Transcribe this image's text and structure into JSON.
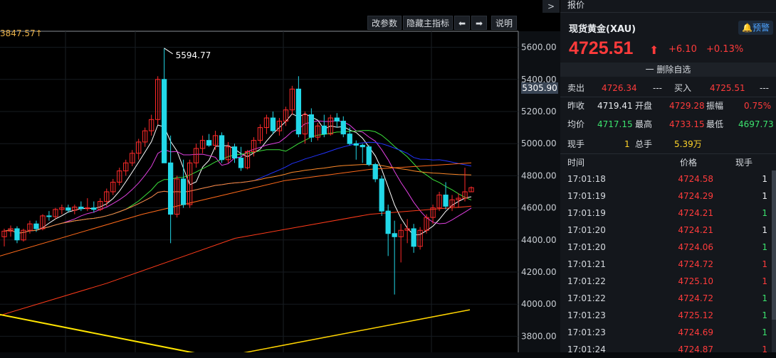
{
  "toolbar": {
    "modify_params": "改参数",
    "hide_indicator": "隐藏主指标",
    "left_arrow": "⬅",
    "right_arrow": "➡",
    "explain": "说明",
    "scroll_arrow": ">"
  },
  "chart_label": "3847.57↑",
  "current_price_tag": "5305.90",
  "chart_data": {
    "type": "candlestick",
    "y_axis_ticks": [
      "5600.00",
      "5400.00",
      "5200.00",
      "5000.00",
      "4800.00",
      "4600.00",
      "4400.00",
      "4200.00",
      "4000.00",
      "3800.00"
    ],
    "ylim": [
      3800,
      5600
    ],
    "peak_annotation": "5594.77",
    "colors": {
      "up": "#ff2a2a",
      "down": "#22d8e8",
      "ma5": "#ffffff",
      "ma10": "#ffd400",
      "ma20": "#e040e0",
      "ma30": "#3be03b",
      "ma60": "#2233ff",
      "ma120": "#ff3b1a",
      "ma250": "#ff8a2a"
    },
    "candles": [
      {
        "o": 4420,
        "h": 4470,
        "l": 4360,
        "c": 4455
      },
      {
        "o": 4455,
        "h": 4490,
        "l": 4420,
        "c": 4470
      },
      {
        "o": 4470,
        "h": 4485,
        "l": 4380,
        "c": 4400
      },
      {
        "o": 4400,
        "h": 4470,
        "l": 4390,
        "c": 4460
      },
      {
        "o": 4460,
        "h": 4520,
        "l": 4440,
        "c": 4500
      },
      {
        "o": 4500,
        "h": 4520,
        "l": 4450,
        "c": 4470
      },
      {
        "o": 4470,
        "h": 4560,
        "l": 4460,
        "c": 4550
      },
      {
        "o": 4550,
        "h": 4580,
        "l": 4520,
        "c": 4545
      },
      {
        "o": 4545,
        "h": 4600,
        "l": 4530,
        "c": 4590
      },
      {
        "o": 4590,
        "h": 4620,
        "l": 4560,
        "c": 4600
      },
      {
        "o": 4600,
        "h": 4620,
        "l": 4570,
        "c": 4585
      },
      {
        "o": 4585,
        "h": 4620,
        "l": 4560,
        "c": 4605
      },
      {
        "o": 4605,
        "h": 4640,
        "l": 4580,
        "c": 4595
      },
      {
        "o": 4595,
        "h": 4660,
        "l": 4580,
        "c": 4600
      },
      {
        "o": 4600,
        "h": 4640,
        "l": 4570,
        "c": 4590
      },
      {
        "o": 4590,
        "h": 4660,
        "l": 4580,
        "c": 4640
      },
      {
        "o": 4640,
        "h": 4720,
        "l": 4610,
        "c": 4700
      },
      {
        "o": 4700,
        "h": 4780,
        "l": 4680,
        "c": 4760
      },
      {
        "o": 4760,
        "h": 4850,
        "l": 4740,
        "c": 4830
      },
      {
        "o": 4830,
        "h": 4900,
        "l": 4800,
        "c": 4880
      },
      {
        "o": 4880,
        "h": 4960,
        "l": 4860,
        "c": 4940
      },
      {
        "o": 4940,
        "h": 5030,
        "l": 4900,
        "c": 5010
      },
      {
        "o": 5010,
        "h": 5100,
        "l": 4980,
        "c": 5080
      },
      {
        "o": 5080,
        "h": 5180,
        "l": 5050,
        "c": 5150
      },
      {
        "o": 5150,
        "h": 5420,
        "l": 5120,
        "c": 5400
      },
      {
        "o": 5400,
        "h": 5594.77,
        "l": 4900,
        "c": 4880
      },
      {
        "o": 4880,
        "h": 5050,
        "l": 4380,
        "c": 4560
      },
      {
        "o": 4560,
        "h": 4800,
        "l": 4540,
        "c": 4780
      },
      {
        "o": 4780,
        "h": 4900,
        "l": 4600,
        "c": 4620
      },
      {
        "o": 4620,
        "h": 4900,
        "l": 4600,
        "c": 4880
      },
      {
        "o": 4880,
        "h": 5000,
        "l": 4850,
        "c": 4970
      },
      {
        "o": 4970,
        "h": 5050,
        "l": 4940,
        "c": 5020
      },
      {
        "o": 5020,
        "h": 5060,
        "l": 4980,
        "c": 4990
      },
      {
        "o": 4990,
        "h": 5080,
        "l": 4960,
        "c": 5050
      },
      {
        "o": 5050,
        "h": 5070,
        "l": 4880,
        "c": 4900
      },
      {
        "o": 4900,
        "h": 5010,
        "l": 4880,
        "c": 4980
      },
      {
        "o": 4980,
        "h": 5000,
        "l": 4880,
        "c": 4910
      },
      {
        "o": 4910,
        "h": 4980,
        "l": 4830,
        "c": 4850
      },
      {
        "o": 4850,
        "h": 4960,
        "l": 4840,
        "c": 4950
      },
      {
        "o": 4950,
        "h": 5040,
        "l": 4920,
        "c": 5020
      },
      {
        "o": 5020,
        "h": 5120,
        "l": 5000,
        "c": 5100
      },
      {
        "o": 5100,
        "h": 5180,
        "l": 5060,
        "c": 5160
      },
      {
        "o": 5160,
        "h": 5200,
        "l": 5060,
        "c": 5080
      },
      {
        "o": 5080,
        "h": 5160,
        "l": 5050,
        "c": 5140
      },
      {
        "o": 5140,
        "h": 5230,
        "l": 5110,
        "c": 5210
      },
      {
        "o": 5210,
        "h": 5360,
        "l": 5180,
        "c": 5340
      },
      {
        "o": 5340,
        "h": 5420,
        "l": 5040,
        "c": 5060
      },
      {
        "o": 5060,
        "h": 5200,
        "l": 5000,
        "c": 5180
      },
      {
        "o": 5180,
        "h": 5220,
        "l": 5010,
        "c": 5040
      },
      {
        "o": 5040,
        "h": 5130,
        "l": 5020,
        "c": 5110
      },
      {
        "o": 5110,
        "h": 5180,
        "l": 5040,
        "c": 5060
      },
      {
        "o": 5060,
        "h": 5180,
        "l": 5050,
        "c": 5160
      },
      {
        "o": 5160,
        "h": 5190,
        "l": 5100,
        "c": 5140
      },
      {
        "o": 5140,
        "h": 5170,
        "l": 5040,
        "c": 5060
      },
      {
        "o": 5060,
        "h": 5100,
        "l": 4990,
        "c": 5000
      },
      {
        "o": 5000,
        "h": 5020,
        "l": 4900,
        "c": 4990
      },
      {
        "o": 4990,
        "h": 5000,
        "l": 4880,
        "c": 4980
      },
      {
        "o": 4980,
        "h": 4990,
        "l": 4860,
        "c": 4870
      },
      {
        "o": 4870,
        "h": 4880,
        "l": 4760,
        "c": 4780
      },
      {
        "o": 4780,
        "h": 4800,
        "l": 4550,
        "c": 4580
      },
      {
        "o": 4580,
        "h": 4620,
        "l": 4300,
        "c": 4440
      },
      {
        "o": 4440,
        "h": 4520,
        "l": 4060,
        "c": 4420
      },
      {
        "o": 4420,
        "h": 4500,
        "l": 4260,
        "c": 4460
      },
      {
        "o": 4460,
        "h": 4530,
        "l": 4380,
        "c": 4470
      },
      {
        "o": 4470,
        "h": 4500,
        "l": 4320,
        "c": 4360
      },
      {
        "o": 4360,
        "h": 4480,
        "l": 4340,
        "c": 4460
      },
      {
        "o": 4460,
        "h": 4560,
        "l": 4440,
        "c": 4540
      },
      {
        "o": 4540,
        "h": 4620,
        "l": 4500,
        "c": 4600
      },
      {
        "o": 4600,
        "h": 4700,
        "l": 4580,
        "c": 4680
      },
      {
        "o": 4680,
        "h": 4760,
        "l": 4590,
        "c": 4610
      },
      {
        "o": 4610,
        "h": 4680,
        "l": 4580,
        "c": 4650
      },
      {
        "o": 4650,
        "h": 4690,
        "l": 4600,
        "c": 4660
      },
      {
        "o": 4660,
        "h": 4850,
        "l": 4640,
        "c": 4700
      },
      {
        "o": 4700,
        "h": 4733.15,
        "l": 4697.73,
        "c": 4725.51
      }
    ]
  },
  "panel": {
    "tab": "报价",
    "title": "现货黄金(XAU)",
    "alert": "预警",
    "price": "4725.51",
    "arrow": "⬆",
    "change": "+6.10",
    "change_pct": "+0.13%",
    "remove_fav": "一 删除自选",
    "sell_label": "卖出",
    "sell_value": "4726.34",
    "sell_extra": "---",
    "buy_label": "买入",
    "buy_value": "4725.51",
    "buy_extra": "---",
    "prev_close_label": "昨收",
    "prev_close": "4719.41",
    "open_label": "开盘",
    "open": "4729.28",
    "amp_label": "振幅",
    "amp": "0.75%",
    "avg_label": "均价",
    "avg": "4717.15",
    "high_label": "最高",
    "high": "4733.15",
    "low_label": "最低",
    "low": "4697.73",
    "cur_vol_label": "现手",
    "cur_vol": "1",
    "total_vol_label": "总手",
    "total_vol": "5.39万",
    "col_time": "时间",
    "col_price": "价格",
    "col_vol": "现手",
    "ticks": [
      {
        "time": "17:01:18",
        "price": "4724.58",
        "vol": "1",
        "vol_color": "white"
      },
      {
        "time": "17:01:19",
        "price": "4724.29",
        "vol": "1",
        "vol_color": "white"
      },
      {
        "time": "17:01:19",
        "price": "4724.21",
        "vol": "1",
        "vol_color": "green"
      },
      {
        "time": "17:01:20",
        "price": "4724.21",
        "vol": "1",
        "vol_color": "white"
      },
      {
        "time": "17:01:20",
        "price": "4724.06",
        "vol": "1",
        "vol_color": "green"
      },
      {
        "time": "17:01:21",
        "price": "4724.72",
        "vol": "1",
        "vol_color": "red"
      },
      {
        "time": "17:01:22",
        "price": "4725.10",
        "vol": "1",
        "vol_color": "red"
      },
      {
        "time": "17:01:22",
        "price": "4724.72",
        "vol": "1",
        "vol_color": "green"
      },
      {
        "time": "17:01:23",
        "price": "4725.12",
        "vol": "1",
        "vol_color": "green"
      },
      {
        "time": "17:01:23",
        "price": "4724.69",
        "vol": "1",
        "vol_color": "green"
      },
      {
        "time": "17:01:24",
        "price": "4724.87",
        "vol": "1",
        "vol_color": "red"
      }
    ]
  }
}
